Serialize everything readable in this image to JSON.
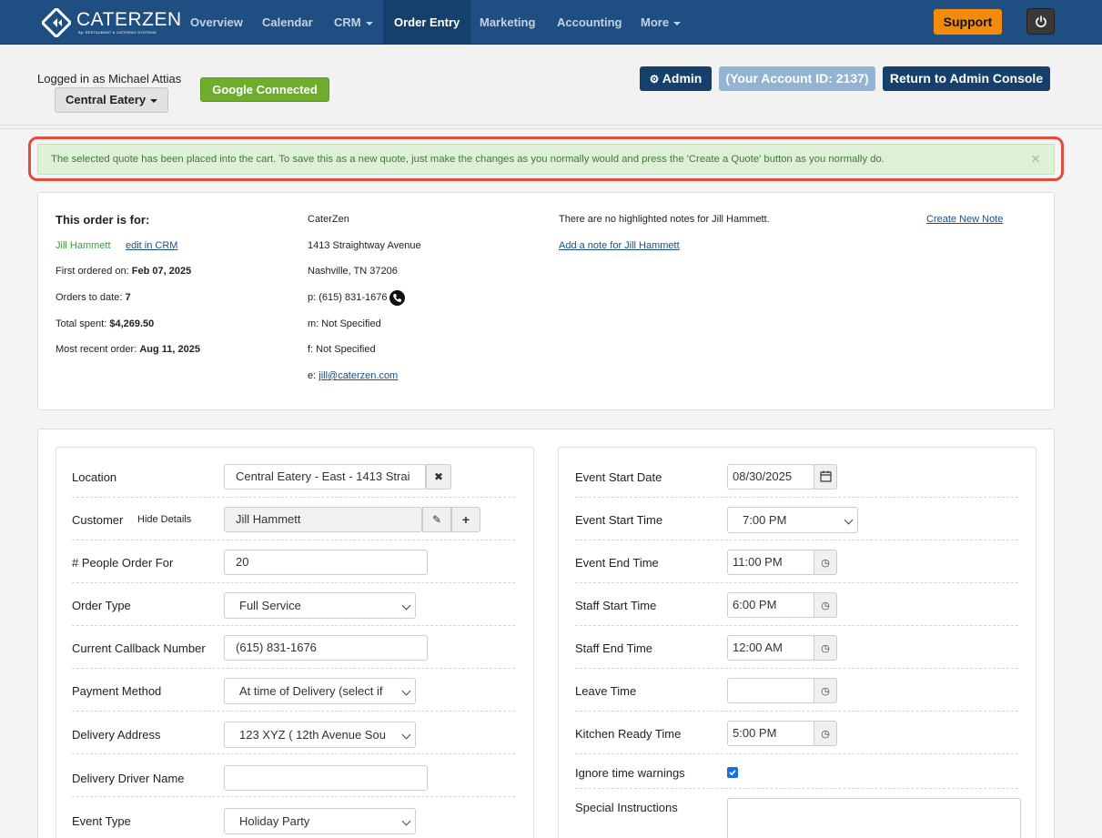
{
  "nav": {
    "brand_name": "CATERZEN",
    "brand_tagline": "By: RESTAURANT & CATERING SYSTEMS",
    "items": [
      "Overview",
      "Calendar",
      "CRM",
      "Order Entry",
      "Marketing",
      "Accounting",
      "More"
    ],
    "support_label": "Support"
  },
  "header": {
    "logged_in_text": "Logged in as Michael Attias",
    "store_selector": "Central Eatery",
    "google_status": "Google Connected",
    "admin_label": "Admin",
    "account_id_label": "(Your Account ID: 2137)",
    "return_label": "Return to Admin Console"
  },
  "alert": {
    "message": "The selected quote has been placed into the cart. To save this as a new quote, just make the changes as you normally would and press the 'Create a Quote' button as you normally do.",
    "close_symbol": "×"
  },
  "customer_info": {
    "heading": "This order is for:",
    "name": "Jill Hammett",
    "edit_link": "edit in CRM",
    "first_ordered_label": "First ordered on:",
    "first_ordered_value": "Feb 07, 2025",
    "orders_label": "Orders to date:",
    "orders_value": "7",
    "spent_label": "Total spent:",
    "spent_value": "$4,269.50",
    "recent_label": "Most recent order:",
    "recent_value": "Aug 11, 2025",
    "company": "CaterZen",
    "street": "1413 Straightway Avenue",
    "city": "Nashville, TN 37206",
    "phone": "p: (615) 831-1676",
    "mobile": "m: Not Specified",
    "fax": "f: Not Specified",
    "email_prefix": "e:",
    "email": "jill@caterzen.com",
    "notes_text": "There are no highlighted notes for Jill Hammett.",
    "add_note_link": "Add a note for Jill Hammett",
    "create_note_link": "Create New Note"
  },
  "order_form": {
    "location_label": "Location",
    "location_value": "Central Eatery - East - 1413 Strai",
    "customer_label": "Customer",
    "hide_details": "Hide Details",
    "customer_value": "Jill Hammett",
    "people_label": "# People Order For",
    "people_value": "20",
    "order_type_label": "Order Type",
    "order_type_value": "Full Service",
    "callback_label": "Current Callback Number",
    "callback_value": "(615) 831-1676",
    "payment_label": "Payment Method",
    "payment_value": "At time of Delivery (select if",
    "address_label": "Delivery Address",
    "address_value": "123 XYZ ( 12th Avenue Sou",
    "driver_label": "Delivery Driver Name",
    "driver_value": "",
    "event_type_label": "Event Type",
    "event_type_value": "Holiday Party"
  },
  "event_form": {
    "start_date_label": "Event Start Date",
    "start_date_value": "08/30/2025",
    "start_time_label": "Event Start Time",
    "start_time_value": "7:00 PM",
    "end_time_label": "Event End Time",
    "end_time_value": "11:00 PM",
    "staff_start_label": "Staff Start Time",
    "staff_start_value": "6:00 PM",
    "staff_end_label": "Staff End Time",
    "staff_end_value": "12:00 AM",
    "leave_label": "Leave Time",
    "leave_value": "",
    "kitchen_label": "Kitchen Ready Time",
    "kitchen_value": "5:00 PM",
    "ignore_label": "Ignore time warnings",
    "ignore_checked": true,
    "instructions_label": "Special Instructions"
  }
}
